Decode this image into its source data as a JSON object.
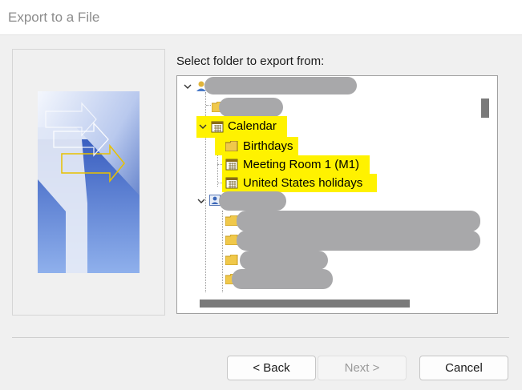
{
  "window": {
    "title": "Export to a File"
  },
  "prompt": "Select folder to export from:",
  "tree": {
    "items": [
      {
        "label": "Calendar"
      },
      {
        "label": "Birthdays"
      },
      {
        "label": "Meeting Room 1 (M1)"
      },
      {
        "label": "United States holidays"
      }
    ],
    "highlight_color": "#fff200"
  },
  "buttons": {
    "back": "< Back",
    "next": "Next >",
    "cancel": "Cancel"
  }
}
